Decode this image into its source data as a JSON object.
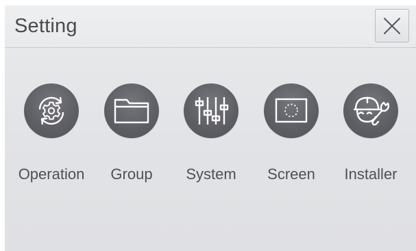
{
  "window": {
    "title": "Setting",
    "close_icon": "close-icon"
  },
  "menu": {
    "items": [
      {
        "label": "Operation",
        "icon": "gear-cycle-icon"
      },
      {
        "label": "Group",
        "icon": "folder-icon"
      },
      {
        "label": "System",
        "icon": "sliders-icon"
      },
      {
        "label": "Screen",
        "icon": "screen-icon"
      },
      {
        "label": "Installer",
        "icon": "installer-wrench-icon"
      }
    ]
  },
  "colors": {
    "icon_circle": "#5d5d64",
    "label_text": "#4f5055",
    "background": "#e4e5e8"
  }
}
